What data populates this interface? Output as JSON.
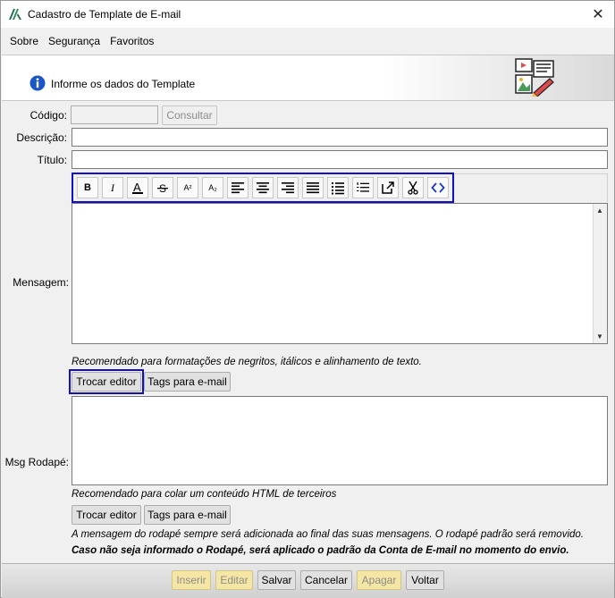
{
  "window": {
    "title": "Cadastro de Template de E-mail",
    "close_label": "✕"
  },
  "menu": {
    "items": [
      {
        "label": "Sobre"
      },
      {
        "label": "Segurança"
      },
      {
        "label": "Favoritos"
      }
    ]
  },
  "header": {
    "info_text": "Informe os dados do Template"
  },
  "form": {
    "codigo": {
      "label": "Código:",
      "value": "",
      "button": "Consultar"
    },
    "descricao": {
      "label": "Descrição:",
      "value": ""
    },
    "titulo": {
      "label": "Título:",
      "value": ""
    },
    "mensagem": {
      "label": "Mensagem:"
    },
    "rodape": {
      "label": "Msg Rodapé:"
    }
  },
  "toolbar": {
    "buttons": [
      {
        "icon": "bold-icon",
        "glyph": "B"
      },
      {
        "icon": "italic-icon",
        "glyph": "I"
      },
      {
        "icon": "font-color-icon",
        "glyph": "A"
      },
      {
        "icon": "strikethrough-icon",
        "glyph": "S"
      },
      {
        "icon": "superscript-icon",
        "glyph": "A²"
      },
      {
        "icon": "subscript-icon",
        "glyph": "A₂"
      },
      {
        "icon": "align-left-icon"
      },
      {
        "icon": "align-center-icon"
      },
      {
        "icon": "align-right-icon"
      },
      {
        "icon": "align-justify-icon"
      },
      {
        "icon": "bullet-list-icon"
      },
      {
        "icon": "numbered-list-icon"
      },
      {
        "icon": "external-link-icon"
      },
      {
        "icon": "cut-icon"
      },
      {
        "icon": "code-icon"
      }
    ]
  },
  "mensagem_hint": "Recomendado para formatações de negritos, itálicos e alinhamento de texto.",
  "mensagem_buttons": {
    "trocar_editor": "Trocar editor",
    "tags_email": "Tags para e-mail"
  },
  "rodape_hint": "Recomendado para colar um conteúdo HTML de terceiros",
  "rodape_buttons": {
    "trocar_editor": "Trocar editor",
    "tags_email": "Tags para e-mail"
  },
  "footer_notes": {
    "note1": "A mensagem do rodapé sempre será adicionada ao final das suas mensagens. O rodapé padrão será removido.",
    "note2": "Caso não seja informado o Rodapé, será aplicado o padrão da Conta de E-mail no momento do envio."
  },
  "actions": {
    "inserir": "Inserir",
    "editar": "Editar",
    "salvar": "Salvar",
    "cancelar": "Cancelar",
    "apagar": "Apagar",
    "voltar": "Voltar"
  },
  "colors": {
    "highlight": "#1010c8",
    "info_blue": "#1a56c8"
  }
}
